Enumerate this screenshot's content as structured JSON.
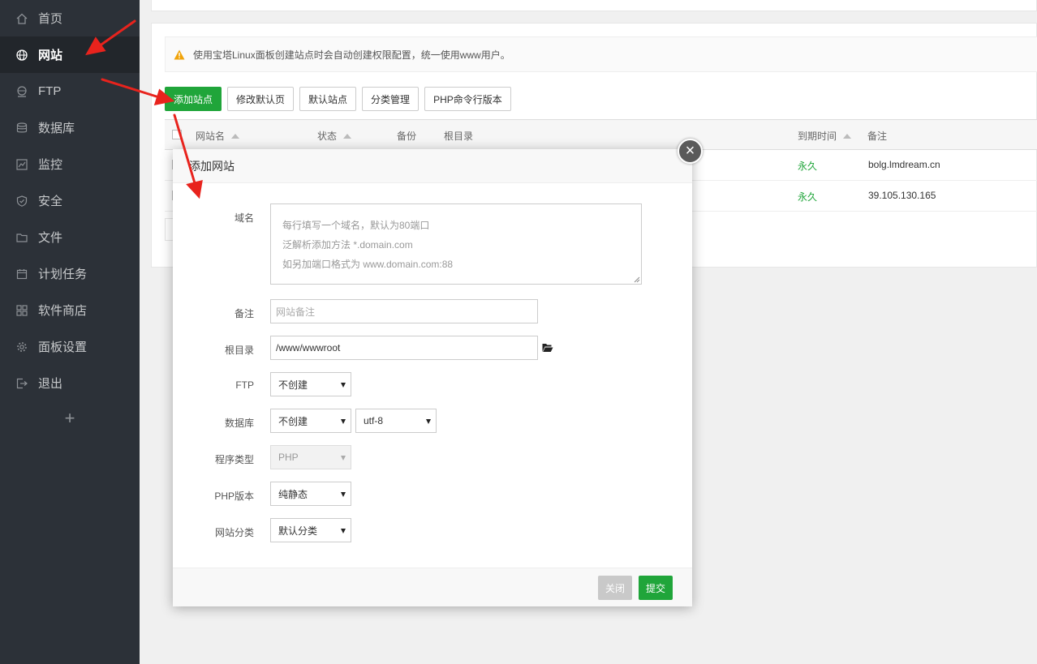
{
  "sidebar": {
    "items": [
      {
        "label": "首页",
        "icon": "home-icon"
      },
      {
        "label": "网站",
        "icon": "globe-icon"
      },
      {
        "label": "FTP",
        "icon": "ftp-icon"
      },
      {
        "label": "数据库",
        "icon": "database-icon"
      },
      {
        "label": "监控",
        "icon": "monitor-icon"
      },
      {
        "label": "安全",
        "icon": "shield-icon"
      },
      {
        "label": "文件",
        "icon": "folder-icon"
      },
      {
        "label": "计划任务",
        "icon": "calendar-icon"
      },
      {
        "label": "软件商店",
        "icon": "apps-icon"
      },
      {
        "label": "面板设置",
        "icon": "gear-icon"
      },
      {
        "label": "退出",
        "icon": "logout-icon"
      }
    ],
    "add_label": "+"
  },
  "notice": "使用宝塔Linux面板创建站点时会自动创建权限配置，统一使用www用户。",
  "toolbar": {
    "add_site": "添加站点",
    "modify_default_page": "修改默认页",
    "default_site": "默认站点",
    "category_manage": "分类管理",
    "php_cli_version": "PHP命令行版本"
  },
  "table": {
    "headers": {
      "name": "网站名",
      "status": "状态",
      "backup": "备份",
      "root": "根目录",
      "expire": "到期时间",
      "remark": "备注"
    },
    "rows": [
      {
        "expire": "永久",
        "remark": "bolg.lmdream.cn"
      },
      {
        "expire": "永久",
        "remark": "39.105.130.165"
      }
    ]
  },
  "modal": {
    "title": "添加网站",
    "close_symbol": "×",
    "labels": {
      "domain": "域名",
      "remark": "备注",
      "root": "根目录",
      "ftp": "FTP",
      "database": "数据库",
      "program_type": "程序类型",
      "php_version": "PHP版本",
      "site_category": "网站分类"
    },
    "domain_placeholder_lines": [
      "每行填写一个域名，默认为80端口",
      "泛解析添加方法 *.domain.com",
      "如另加端口格式为 www.domain.com:88"
    ],
    "remark_placeholder": "网站备注",
    "root_value": "/www/wwwroot",
    "ftp_value": "不创建",
    "database_value": "不创建",
    "charset_value": "utf-8",
    "program_type_value": "PHP",
    "php_version_value": "纯静态",
    "site_category_value": "默认分类",
    "close_button": "关闭",
    "submit_button": "提交"
  },
  "colors": {
    "sidebar_bg": "#2c3138",
    "accent_green": "#20a53a",
    "annotation_red": "#e8231d"
  }
}
